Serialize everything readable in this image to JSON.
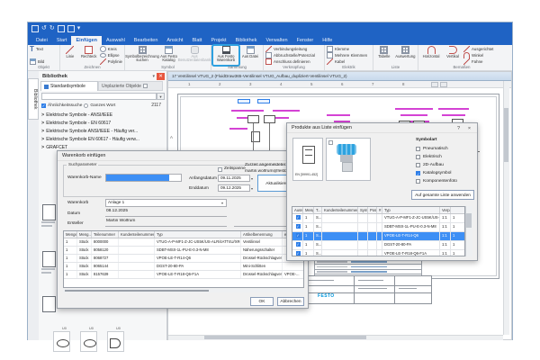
{
  "colors": {
    "accent_blue": "#1f63c4",
    "highlight_border": "#2da0e0",
    "selection_blue": "#3d8ff5",
    "festo_blue": "#0096dc",
    "annotation_magenta": "#cc22cc"
  },
  "ribbon": {
    "tabs": [
      "Datei",
      "Start",
      "Einfügen",
      "Auswahl",
      "Bearbeiten",
      "Ansicht",
      "Blatt",
      "Projekt",
      "Bibliothek",
      "Verwalten",
      "Fenster",
      "Hilfe"
    ],
    "active_tab": "Einfügen",
    "groups": {
      "objekt": {
        "label": "Objekt",
        "text": "Text",
        "bild": "Bild"
      },
      "zeichnen": {
        "label": "Zeichnen",
        "linie": "Linie",
        "rechteck": "Rechteck",
        "kreis": "Kreis",
        "ellipse": "Ellipse",
        "polylinie": "Polylinie"
      },
      "symbol": {
        "label": "Symbol",
        "suchen": "Symbolbezeichnung suchen",
        "katalog": "Aus Festo Katalog",
        "benutzerdb": "Aus Benutzerdatenbank"
      },
      "sammlung": {
        "label": "Sammlung",
        "warenkorb": "Aus Festo Warenkorb",
        "datei": "Aus Datei"
      },
      "verknuepfung": {
        "label": "Verknüpfung",
        "verbindung": "Verbindungsleitung",
        "abbruch": "Abbruchstelle/Potenzial",
        "anschluss": "Anschluss definieren"
      },
      "elektrik": {
        "label": "Elektrik",
        "klemme": "Klemme",
        "mehrere": "Mehrere Klemmen",
        "kabel": "Kabel"
      },
      "liste": {
        "label": "Liste",
        "tabelle": "Tabelle",
        "auswertung": "Auswertung"
      },
      "bemassen": {
        "label": "Bemaßen",
        "horizontal": "Horizontal",
        "vertikal": "Vertikal",
        "ausgerichtet": "Ausgerichtet",
        "winkel": "Winkel",
        "fahne": "Fahne"
      }
    }
  },
  "library": {
    "vertical_tab": "Bibliothek",
    "panel_title": "Bibliothek",
    "tab_standard": "Standardsymbole",
    "tab_unplaced": "Unplazierte Objekte",
    "similarity_label": "Ähnlichkeitssuche",
    "whole_word_label": "Ganzes Wort",
    "result_count": "2117",
    "pin_icon": "▾",
    "close_icon": "✕",
    "search_button_icon": "▾",
    "tree_items": [
      "Elektrische Symbole - ANSI/IEEE",
      "Elektrische Symbole - EN 60617",
      "Elektrische Symbole ANSI/IEEE - Häufig ver...",
      "Elektrische Symbole EN 60617 - Häufig verw...",
      "GRAFCET"
    ],
    "symbol_card_captions": [
      "U0",
      "U0",
      "U0"
    ]
  },
  "drawing": {
    "doc_title": "17 Ventilinsel VTUG_2 (FluidDraw365-Ventilinsel VTUG_Aufbau_dupliziert-Ventilinsel VTUG_2)",
    "ruler_numbers": [
      "1",
      "2",
      "3",
      "4",
      "5",
      "6",
      "7",
      "8"
    ],
    "row_letters": [
      "A",
      "B"
    ],
    "logo_text": "FESTO"
  },
  "products_dialog": {
    "title": "Produkte aus Liste einfügen",
    "help_icon": "?",
    "close_icon": "×",
    "symbol_card_caption": "EN [59991-452]",
    "symbolart_label": "Symbolart",
    "options": [
      "Pneumatisch",
      "Elektrisch",
      "2D-Aufbau",
      "Katalogsymbol",
      "Komponentenfoto"
    ],
    "selected_option": "Katalogsymbol",
    "apply_all_button": "Auf gesamte Liste anwenden",
    "table": {
      "columns": [
        "Ausw...",
        "Meng...",
        "T...",
        "Kundenteilenummer",
        "Sym...",
        "Pos...",
        "#",
        "Typ",
        "Verpacku...",
        ""
      ],
      "rows": [
        {
          "checked": true,
          "cells": [
            "1",
            "S...",
            "",
            "",
            "",
            "",
            "VTUG-A-P-MF1-Z-JC-US5K/US-ALR...",
            "1:1",
            "1"
          ]
        },
        {
          "checked": true,
          "cells": [
            "1",
            "S...",
            "",
            "",
            "",
            "",
            "SDBT-MSX-1L-PU-E-0.3-N-M8",
            "1:1",
            "1"
          ]
        },
        {
          "checked": true,
          "cells": [
            "1",
            "S...",
            "",
            "",
            "",
            "",
            "VPOE-LE-T-R14-Q6",
            "1:1",
            "1"
          ]
        },
        {
          "checked": true,
          "cells": [
            "1",
            "S...",
            "",
            "",
            "",
            "",
            "DGST-20-80-PA",
            "1:1",
            "1"
          ]
        },
        {
          "checked": true,
          "cells": [
            "1",
            "S...",
            "",
            "",
            "",
            "",
            "VPOE-LE-T-R18-Q6-F1A",
            "1:1",
            "1"
          ]
        }
      ],
      "selected_row_index": 2
    }
  },
  "cart_dialog": {
    "title": "Warenkorb einfügen",
    "group_label": "Suchparameter",
    "cart_name_label": "Warenkorb-Name",
    "timespan_label": "Zeitspanne",
    "start_label": "Anfangsdatum",
    "start_value": "09.11.2025",
    "end_label": "Enddatum",
    "end_value": "09.12.2025",
    "refresh_button": "Aktualisieren",
    "user_label": "Zurzeit angemeldeter Benu...",
    "user_email": "martin.wolfrum@festo.com",
    "cart_label": "Warenkorb",
    "cart_value": "Anlage 1",
    "date_label": "Datum",
    "date_value": "08.12.2025",
    "creator_label": "Ersteller",
    "creator_value": "Martin Wolfrum",
    "table": {
      "columns": [
        "Menge",
        "Meng...",
        "Teilenummer",
        "Kundenteilenummer",
        "Typ",
        "Artikelbenennung",
        "e-N..."
      ],
      "rows": [
        [
          "1",
          "Stück",
          "8000000",
          "",
          "VTUG-A-P-MF1-Z-JC-US5K/US-ALR/4ATT4U/XR-(PK)",
          "Ventilinsel",
          ""
        ],
        [
          "1",
          "Stück",
          "8058120",
          "",
          "SDBT-MSX-1L-PU-E-0.3-N-M8",
          "Näherungsschalter",
          ""
        ],
        [
          "1",
          "Stück",
          "8068727",
          "",
          "VPOE-LE-T-R14-Q6",
          "Drossel-Rückschlagventil",
          ""
        ],
        [
          "1",
          "Stück",
          "8065144",
          "",
          "DGST-20-80-PA",
          "Mini-Schlitten",
          ""
        ],
        [
          "1",
          "Stück",
          "8157639",
          "",
          "VPOE-LE-T-R18-Q6-F1A",
          "Drossel-Rückschlagventil",
          "VPOE-..."
        ]
      ]
    },
    "ok_button": "OK",
    "cancel_button": "Abbrechen"
  }
}
